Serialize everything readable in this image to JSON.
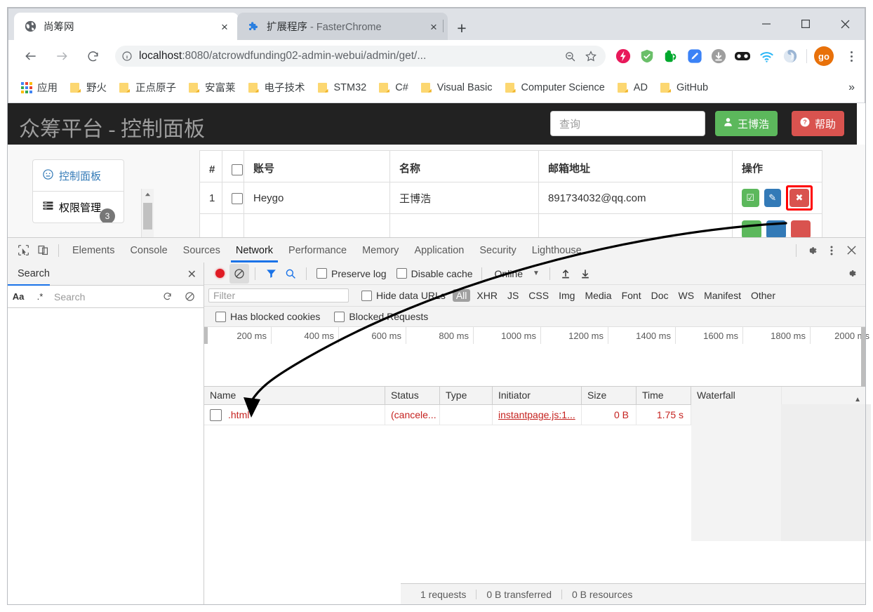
{
  "browser": {
    "tabs": [
      {
        "title": "尚筹网",
        "favicon": "globe-icon",
        "active": true,
        "close_label": "×"
      },
      {
        "title": "扩展程序",
        "title_suffix": " - FasterChrome",
        "favicon": "puzzle-icon",
        "active": false,
        "close_label": "×"
      }
    ],
    "new_tab_label": "+",
    "window_controls": {
      "minimize": "─",
      "maximize": "□",
      "close": "✕"
    },
    "nav": {
      "back_icon": "back-arrow-icon",
      "forward_icon": "forward-arrow-icon",
      "reload_icon": "reload-icon",
      "info_icon": "info-circle-icon",
      "url": "localhost:8080/atcrowdfunding02-admin-webui/admin/get/...",
      "url_host": "localhost",
      "url_rest": ":8080/atcrowdfunding02-admin-webui/admin/get/...",
      "zoom_out_icon": "zoom-out-icon",
      "bookmark_icon": "star-icon"
    },
    "extensions": [
      {
        "name": "lightning-extension-icon",
        "color": "#e8185a"
      },
      {
        "name": "shield-check-extension-icon",
        "color": "#6abf69"
      },
      {
        "name": "evernote-elephant-extension-icon",
        "color": "#00a82d"
      },
      {
        "name": "blue-pen-extension-icon",
        "color": "#3b82f6"
      },
      {
        "name": "download-circle-extension-icon",
        "color": "#9e9e9e"
      },
      {
        "name": "dark-glasses-extension-icon",
        "color": "#1a1a1a"
      },
      {
        "name": "wifi-extension-icon",
        "color": "#29b6f6"
      },
      {
        "name": "swirl-extension-icon",
        "color": "#b0c4de"
      }
    ],
    "profile_label": "go",
    "menu_icon": "three-dot-menu-icon",
    "bookmarks": [
      {
        "label": "应用",
        "icon": "apps-grid-icon"
      },
      {
        "label": "野火",
        "icon": "folder-icon"
      },
      {
        "label": "正点原子",
        "icon": "folder-icon"
      },
      {
        "label": "安富莱",
        "icon": "folder-icon"
      },
      {
        "label": "电子技术",
        "icon": "folder-icon"
      },
      {
        "label": "STM32",
        "icon": "folder-icon"
      },
      {
        "label": "C#",
        "icon": "folder-icon"
      },
      {
        "label": "Visual Basic",
        "icon": "folder-icon"
      },
      {
        "label": "Computer Science",
        "icon": "folder-icon"
      },
      {
        "label": "AD",
        "icon": "folder-icon"
      },
      {
        "label": "GitHub",
        "icon": "folder-icon"
      }
    ],
    "bookmarks_overflow": "»"
  },
  "webpage": {
    "title": "众筹平台 - 控制面板",
    "search_placeholder": "查询",
    "user_button": "王博浩",
    "user_icon": "user-icon",
    "help_button": "帮助",
    "help_icon": "question-circle-icon",
    "sidebar": [
      {
        "label": "控制面板",
        "icon": "dashboard-icon",
        "active": true
      },
      {
        "label": "权限管理",
        "icon": "list-icon",
        "active": false,
        "badge": "3"
      }
    ],
    "table": {
      "headers": [
        "#",
        "",
        "账号",
        "名称",
        "邮箱地址",
        "操作"
      ],
      "rows": [
        {
          "index": "1",
          "account": "Heygo",
          "name": "王博浩",
          "email": "891734032@qq.com",
          "actions": [
            {
              "name": "check-button",
              "glyph": "☑"
            },
            {
              "name": "edit-button",
              "glyph": "✎"
            },
            {
              "name": "delete-button",
              "glyph": "✖",
              "highlighted": true
            }
          ]
        }
      ]
    }
  },
  "devtools": {
    "inspect_icon": "inspect-cursor-icon",
    "device_icon": "device-toolbar-icon",
    "tabs": [
      {
        "label": "Elements",
        "active": false
      },
      {
        "label": "Console",
        "active": false
      },
      {
        "label": "Sources",
        "active": false
      },
      {
        "label": "Network",
        "active": true
      },
      {
        "label": "Performance",
        "active": false
      },
      {
        "label": "Memory",
        "active": false
      },
      {
        "label": "Application",
        "active": false
      },
      {
        "label": "Security",
        "active": false
      },
      {
        "label": "Lighthouse",
        "active": false
      }
    ],
    "settings_icon": "gear-icon",
    "more_icon": "three-dot-menu-icon",
    "close_icon": "close-icon",
    "search_panel": {
      "title": "Search",
      "close_label": "✕",
      "match_case": "Aa",
      "regex": ".*",
      "input_placeholder": "Search",
      "refresh_icon": "refresh-icon",
      "clear_icon": "clear-icon"
    },
    "network_toolbar": {
      "record_icon": "record-dot-icon",
      "clear_icon": "clear-no-entry-icon",
      "filter_icon": "funnel-icon",
      "search_icon": "magnifier-icon",
      "preserve_log": "Preserve log",
      "disable_cache": "Disable cache",
      "throttling": "Online",
      "import_icon": "upload-arrow-icon",
      "export_icon": "download-arrow-icon",
      "settings_icon": "gear-icon"
    },
    "filter_bar": {
      "filter_placeholder": "Filter",
      "hide_data_urls": "Hide data URLs",
      "types": [
        "All",
        "XHR",
        "JS",
        "CSS",
        "Img",
        "Media",
        "Font",
        "Doc",
        "WS",
        "Manifest",
        "Other"
      ],
      "active_type": "All"
    },
    "filter_bar2": {
      "has_blocked_cookies": "Has blocked cookies",
      "blocked_requests": "Blocked Requests"
    },
    "timeline_ticks": [
      "200 ms",
      "400 ms",
      "600 ms",
      "800 ms",
      "1000 ms",
      "1200 ms",
      "1400 ms",
      "1600 ms",
      "1800 ms",
      "2000 ms"
    ],
    "request_table": {
      "headers": [
        "Name",
        "Status",
        "Type",
        "Initiator",
        "Size",
        "Time",
        "Waterfall"
      ],
      "sort_indicator": "▲",
      "rows": [
        {
          "name": ".html",
          "status": "(cancele...",
          "type": "",
          "initiator": "instantpage.js:1...",
          "size": "0 B",
          "time": "1.75 s"
        }
      ]
    },
    "status_bar": {
      "requests": "1 requests",
      "transferred": "0 B transferred",
      "resources": "0 B resources"
    }
  },
  "annotation": {
    "arrow_name": "annotation-arrow",
    "color": "#000000"
  },
  "colors": {
    "accent_blue": "#1a73e8",
    "success_green": "#5cb85c",
    "danger_red": "#d9534f",
    "highlight_red": "#ff0000",
    "devtools_bg": "#f3f3f3",
    "site_header_bg": "#222222"
  }
}
